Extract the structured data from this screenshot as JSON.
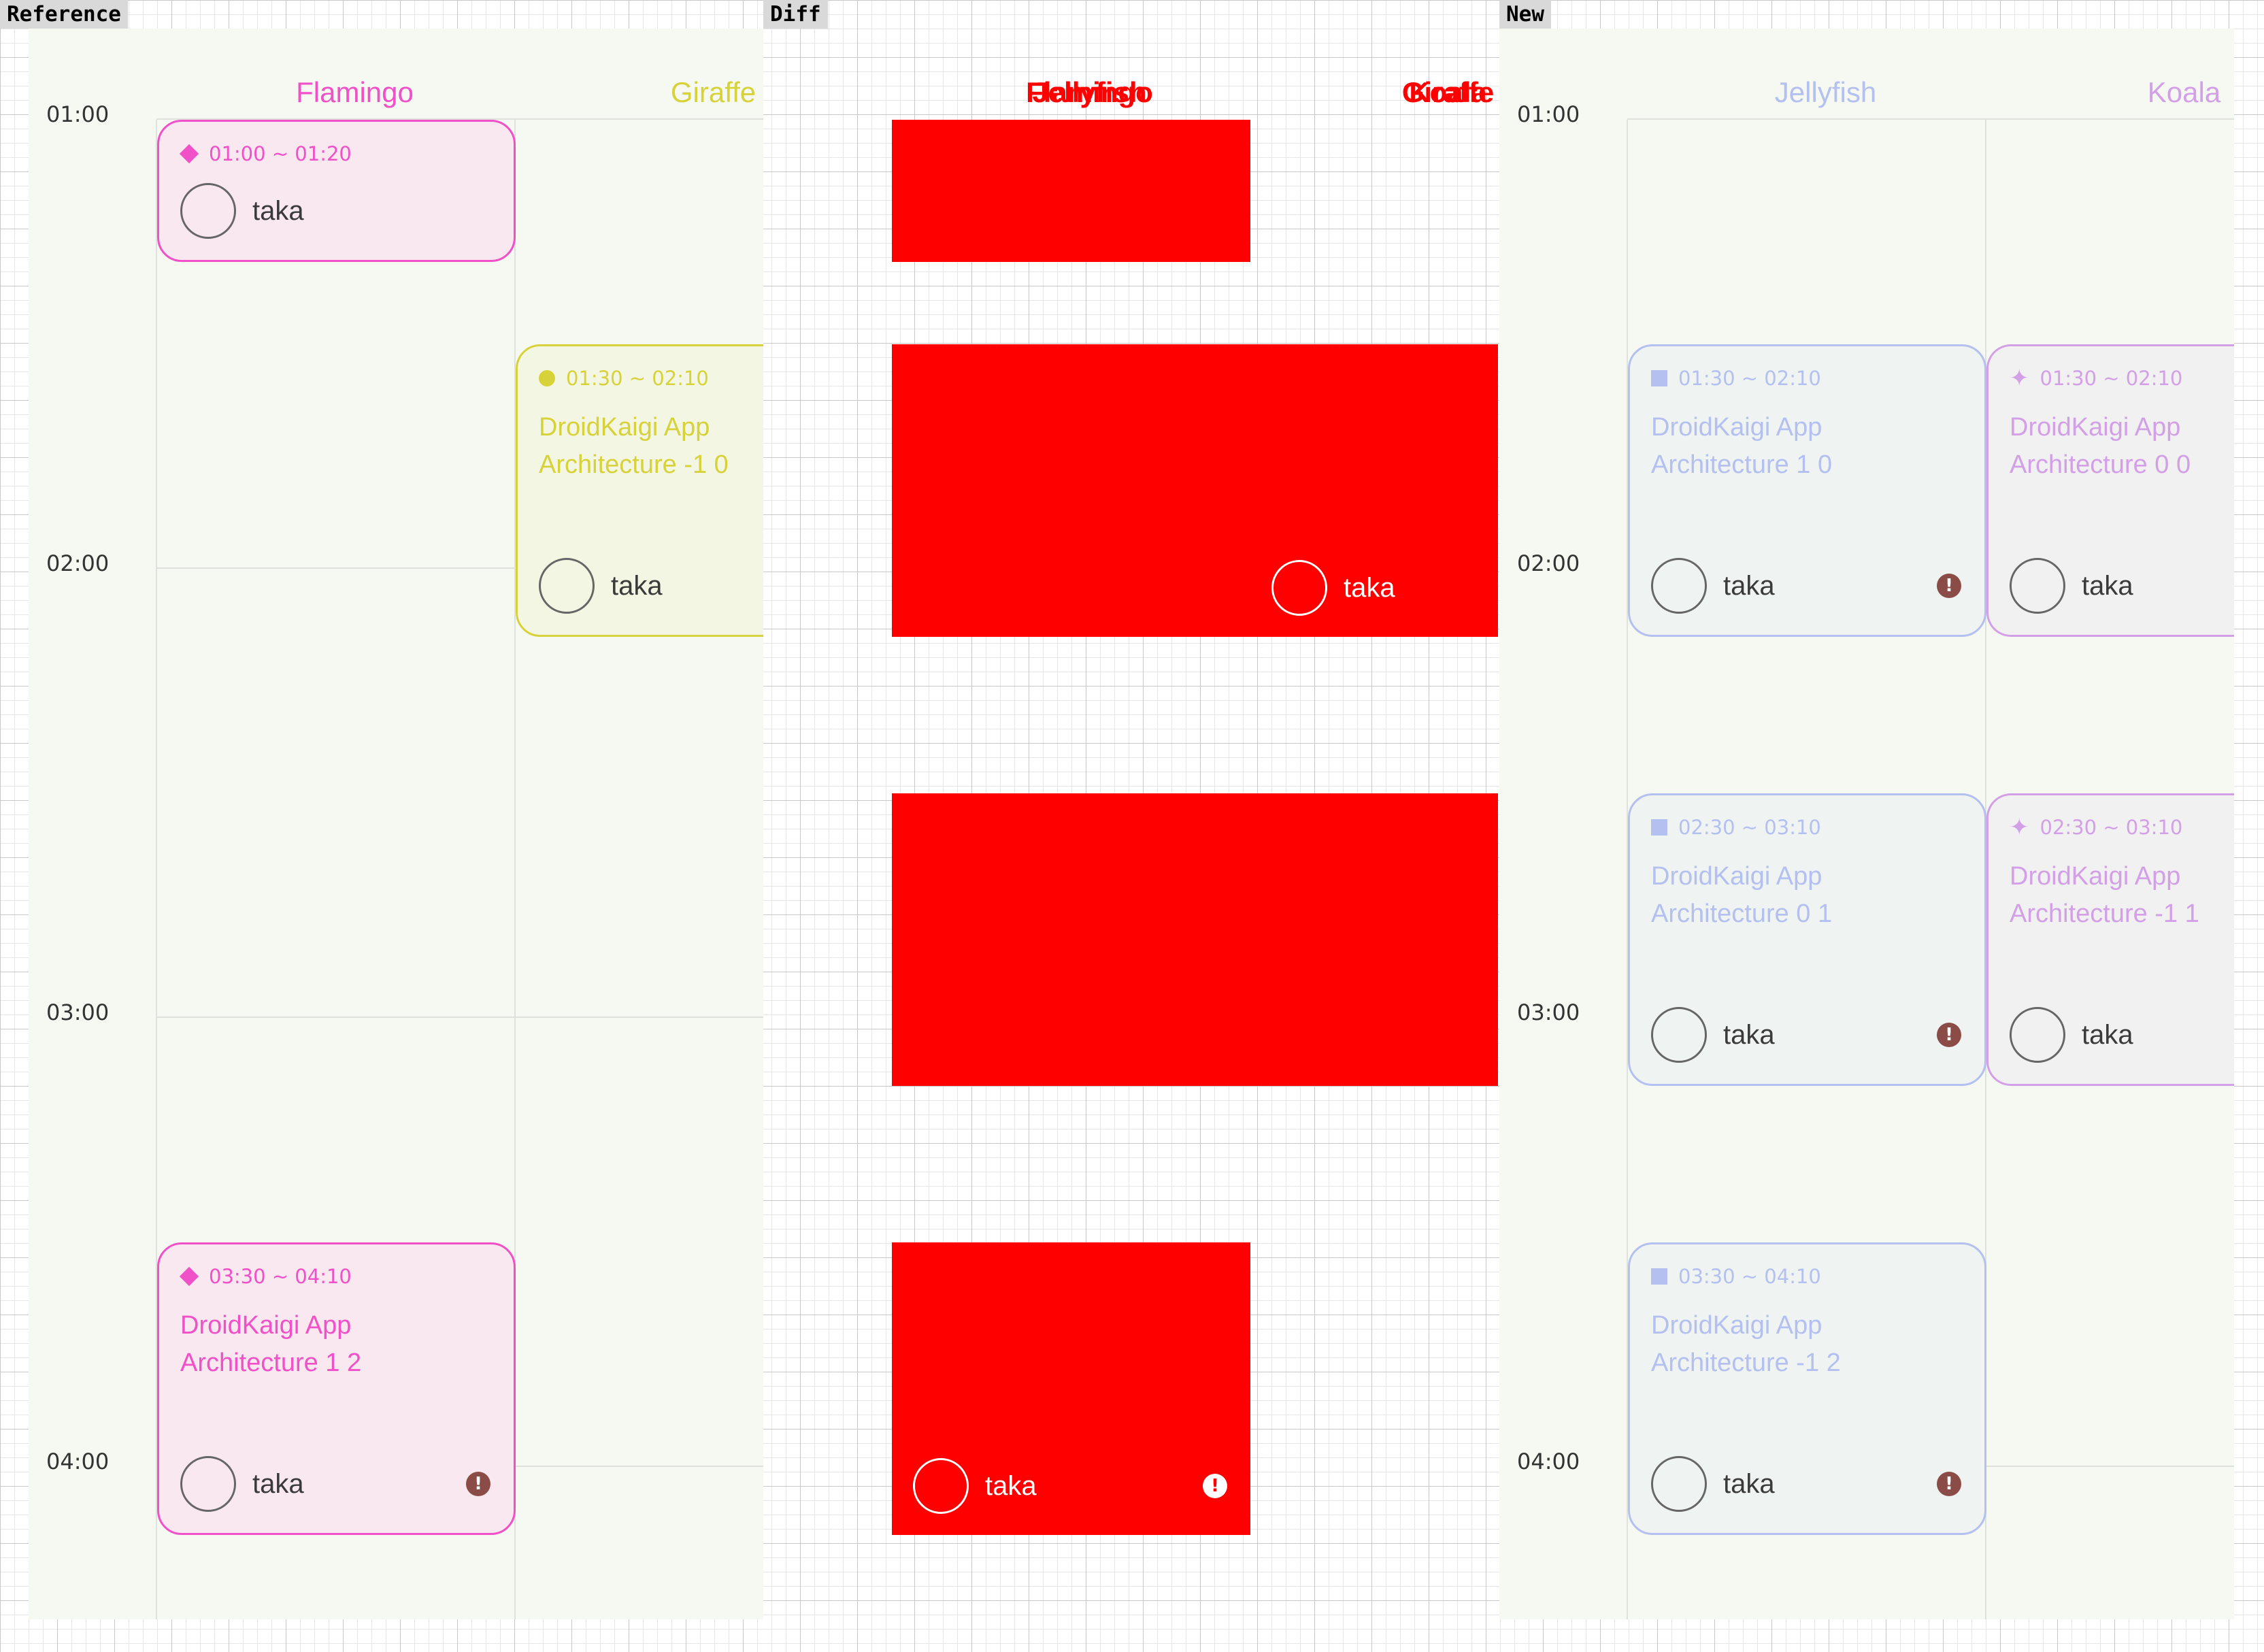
{
  "panels": {
    "reference": {
      "label": "Reference",
      "rooms": [
        {
          "name": "Flamingo",
          "color": "#f050c8"
        },
        {
          "name": "Giraffe",
          "color": "#d8d23a"
        }
      ],
      "times": [
        "01:00",
        "02:00",
        "03:00",
        "04:00"
      ],
      "sessions": [
        {
          "time": "01:00 ~ 01:20",
          "title": "",
          "speaker": "taka"
        },
        {
          "time": "01:30 ~ 02:10",
          "title": "DroidKaigi App Architecture -1 0",
          "speaker": "taka"
        },
        {
          "time": "03:30 ~ 04:10",
          "title": "DroidKaigi App Architecture 1 2",
          "speaker": "taka",
          "warning": "!"
        }
      ]
    },
    "diff": {
      "label": "Diff",
      "rooms": [
        "Flamingo",
        "Jellyfish",
        "Giraffe",
        "Koala"
      ],
      "speakers": [
        {
          "name": "taka"
        },
        {
          "name": "taka",
          "warning": "!"
        }
      ]
    },
    "new": {
      "label": "New",
      "rooms": [
        {
          "name": "Jellyfish",
          "color": "#b3c0f0"
        },
        {
          "name": "Koala",
          "color": "#d3a0e8"
        }
      ],
      "times": [
        "01:00",
        "02:00",
        "03:00",
        "04:00"
      ],
      "sessions": [
        {
          "time": "01:30 ~ 02:10",
          "title": "DroidKaigi App Architecture 1 0",
          "speaker": "taka",
          "warning": "!"
        },
        {
          "time": "01:30 ~ 02:10",
          "title": "DroidKaigi App Architecture 0 0",
          "speaker": "taka"
        },
        {
          "time": "02:30 ~ 03:10",
          "title": "DroidKaigi App Architecture 0 1",
          "speaker": "taka",
          "warning": "!"
        },
        {
          "time": "02:30 ~ 03:10",
          "title": "DroidKaigi App Architecture -1 1",
          "speaker": "taka"
        },
        {
          "time": "03:30 ~ 04:10",
          "title": "DroidKaigi App Architecture -1 2",
          "speaker": "taka",
          "warning": "!"
        }
      ]
    }
  },
  "colors": {
    "flamingo_bg": "#f9e8f0",
    "giraffe_bg": "#f3f6e2",
    "jelly_koala_bg": "#eff3f2",
    "diff": "#ff0000",
    "warning": "#8b4b46"
  },
  "icons": {
    "flamingo": "diamond-icon",
    "giraffe": "circle-icon",
    "jellyfish": "square-icon",
    "koala": "sparkle-icon",
    "warning": "error-icon"
  }
}
